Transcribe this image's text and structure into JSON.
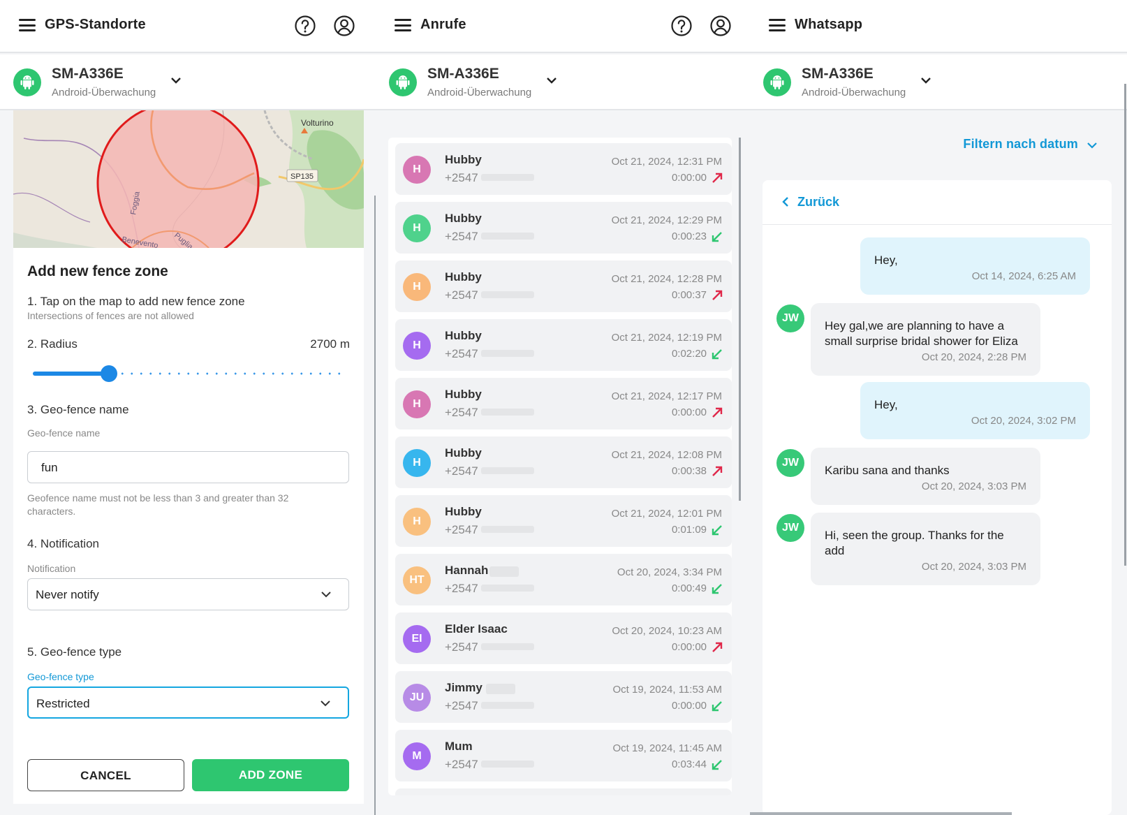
{
  "device": {
    "name": "SM-A336E",
    "subtitle": "Android-Überwachung"
  },
  "gps": {
    "title": "GPS-Standorte",
    "map": {
      "labels": [
        "Volturino",
        "SP135",
        "Foggia",
        "Benevento",
        "Puglia"
      ]
    },
    "form": {
      "heading": "Add new fence zone",
      "step1": "1. Tap on the map to add new fence zone",
      "step1_hint": "Intersections of fences are not allowed",
      "step2": "2. Radius",
      "radius_value": "2700 m",
      "radius_fraction": 0.245,
      "step3": "3. Geo-fence name",
      "name_label": "Geo-fence name",
      "name_value": "fun",
      "name_hint_line1": "Geofence name must not be less than 3 and greater than 32",
      "name_hint_line2": "characters.",
      "step4": "4. Notification",
      "notification_label": "Notification",
      "notification_value": "Never notify",
      "step5": "5. Geo-fence type",
      "type_label": "Geo-fence type",
      "type_value": "Restricted",
      "cancel_label": "CANCEL",
      "add_label": "ADD ZONE"
    }
  },
  "calls": {
    "title": "Anrufe",
    "items": [
      {
        "initials": "H",
        "name": "Hubby",
        "number": "+2547",
        "date": "Oct 21, 2024, 12:31 PM",
        "duration": "0:00:00",
        "direction": "outgoing",
        "color": "#d877b3"
      },
      {
        "initials": "H",
        "name": "Hubby",
        "number": "+2547",
        "date": "Oct 21, 2024, 12:29 PM",
        "duration": "0:00:23",
        "direction": "incoming",
        "color": "#4fd28c"
      },
      {
        "initials": "H",
        "name": "Hubby",
        "number": "+2547",
        "date": "Oct 21, 2024, 12:28 PM",
        "duration": "0:00:37",
        "direction": "outgoing",
        "color": "#f9b87a"
      },
      {
        "initials": "H",
        "name": "Hubby",
        "number": "+2547",
        "date": "Oct 21, 2024, 12:19 PM",
        "duration": "0:02:20",
        "direction": "incoming",
        "color": "#a56bf0"
      },
      {
        "initials": "H",
        "name": "Hubby",
        "number": "+2547",
        "date": "Oct 21, 2024, 12:17 PM",
        "duration": "0:00:00",
        "direction": "outgoing",
        "color": "#d877b3"
      },
      {
        "initials": "H",
        "name": "Hubby",
        "number": "+2547",
        "date": "Oct 21, 2024, 12:08 PM",
        "duration": "0:00:38",
        "direction": "outgoing",
        "color": "#37b6ee"
      },
      {
        "initials": "H",
        "name": "Hubby",
        "number": "+2547",
        "date": "Oct 21, 2024, 12:01 PM",
        "duration": "0:01:09",
        "direction": "incoming",
        "color": "#f9c07f"
      },
      {
        "initials": "HT",
        "name": "Hannah",
        "number": "+2547",
        "date": "Oct 20, 2024, 3:34 PM",
        "duration": "0:00:49",
        "direction": "incoming",
        "color": "#f9c07f"
      },
      {
        "initials": "EI",
        "name": "Elder Isaac",
        "number": "+2547",
        "date": "Oct 20, 2024, 10:23 AM",
        "duration": "0:00:00",
        "direction": "outgoing",
        "color": "#a56bf0"
      },
      {
        "initials": "JU",
        "name": "Jimmy",
        "number": "+2547",
        "date": "Oct 19, 2024, 11:53 AM",
        "duration": "0:00:00",
        "direction": "incoming",
        "color": "#b78be6"
      },
      {
        "initials": "M",
        "name": "Mum",
        "number": "+2547",
        "date": "Oct 19, 2024, 11:45 AM",
        "duration": "0:03:44",
        "direction": "incoming",
        "color": "#a56bf0"
      }
    ]
  },
  "whatsapp": {
    "title": "Whatsapp",
    "filter_label": "Filtern nach datum",
    "back_label": "Zurück",
    "messages": [
      {
        "type": "out",
        "lines": [
          "Hey,"
        ],
        "date": "Oct 14, 2024, 6:25 AM"
      },
      {
        "type": "in",
        "avatar": "JW",
        "lines": [
          "Hey gal,we are planning to have a",
          "small surprise bridal shower for Eliza"
        ],
        "date": "Oct 20, 2024, 2:28 PM"
      },
      {
        "type": "out",
        "lines": [
          "Hey,"
        ],
        "date": "Oct 20, 2024, 3:02 PM"
      },
      {
        "type": "in",
        "avatar": "JW",
        "lines": [
          "Karibu sana and thanks"
        ],
        "date": "Oct 20, 2024, 3:03 PM"
      },
      {
        "type": "in",
        "avatar": "JW",
        "lines": [
          "Hi, seen the group. Thanks for the",
          "add"
        ],
        "date": "Oct 20, 2024, 3:03 PM"
      }
    ]
  },
  "colors": {
    "accent_green": "#2ec670",
    "accent_blue": "#1298d6",
    "fence_fill": "#f4b6b4",
    "fence_stroke": "#e01b1b",
    "outgoing_arrow": "#e0284a",
    "incoming_arrow": "#2ec670"
  }
}
